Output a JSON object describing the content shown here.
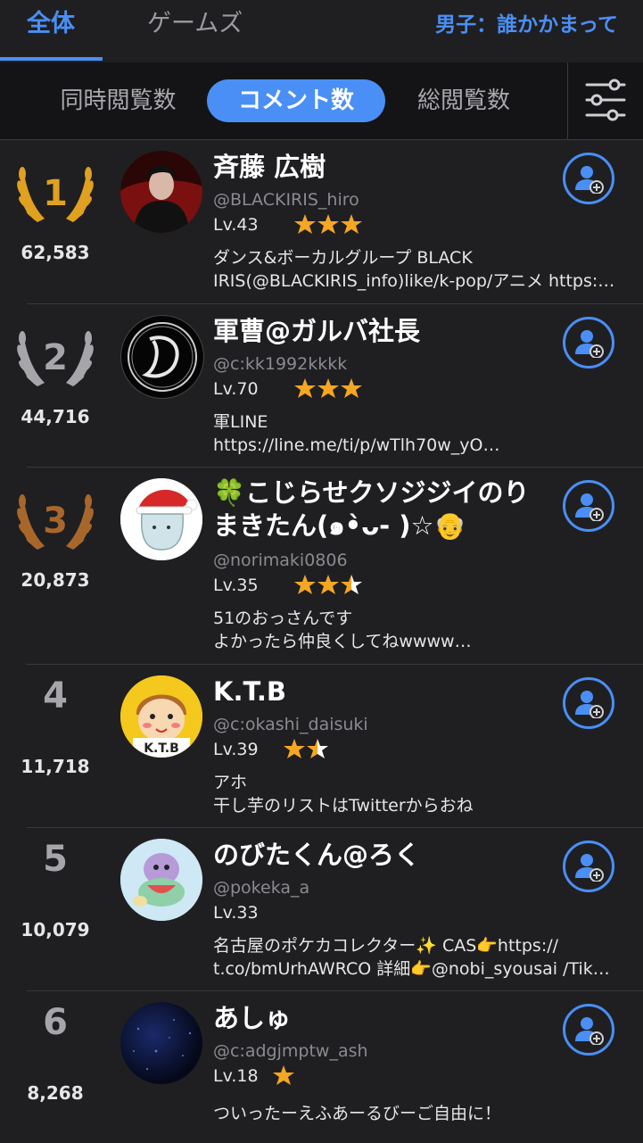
{
  "top_tabs": {
    "all": "全体",
    "games": "ゲームズ",
    "category": "男子：誰かかまって"
  },
  "sort_tabs": {
    "concurrent": "同時閲覧数",
    "comments": "コメント数",
    "total": "総閲覧数"
  },
  "icons": {
    "filter": "sliders-icon",
    "follow": "add-user-icon",
    "laurel": "laurel-wreath-icon",
    "star": "star-icon"
  },
  "colors": {
    "accent": "#4a8ff5",
    "gold": "#e0a020",
    "silver": "#a6a6aa",
    "bronze": "#a8672a",
    "star": "#f5a623"
  },
  "rankings": [
    {
      "rank": "1",
      "count": "62,583",
      "name": "斉藤 広樹",
      "handle": "@BLACKIRIS_hiro",
      "level": "Lv.43",
      "stars": 3,
      "bio1": "ダンス&ボーカルグループ BLACK",
      "bio2": "IRIS(@BLACKIRIS_info)like/k-pop/アニメ https:…"
    },
    {
      "rank": "2",
      "count": "44,716",
      "name": "軍曹@ガルバ社長",
      "handle": "@c:kk1992kkkk",
      "level": "Lv.70",
      "stars": 3,
      "bio1": "軍LINE",
      "bio2": "https://line.me/ti/p/wTlh70w_yO…"
    },
    {
      "rank": "3",
      "count": "20,873",
      "name": "🍀こじらせクソジジイのり",
      "name2": "まきたん(๑•̀ᴗ- )☆👴",
      "handle": "@norimaki0806",
      "level": "Lv.35",
      "stars": 2.5,
      "bio1": "51のおっさんです",
      "bio2": "よかったら仲良くしてねwwww…"
    },
    {
      "rank": "4",
      "count": "11,718",
      "name": "K.T.B",
      "handle": "@c:okashi_daisuki",
      "level": "Lv.39",
      "stars": 1.5,
      "bio1": "アホ",
      "bio2": "干し芋のリストはTwitterからおね"
    },
    {
      "rank": "5",
      "count": "10,079",
      "name": "のびたくん@ろく",
      "handle": "@pokeka_a",
      "level": "Lv.33",
      "stars": 0,
      "bio1": "名古屋のポケカコレクター✨ CAS👉https://",
      "bio2": "t.co/bmUrhAWRCO 詳細👉@nobi_syousai /Tik…"
    },
    {
      "rank": "6",
      "count": "8,268",
      "name": "あしゅ",
      "handle": "@c:adgjmptw_ash",
      "level": "Lv.18",
      "stars": 1,
      "bio1": "ついったーえふあーるびーご自由に！",
      "bio2": ""
    }
  ]
}
